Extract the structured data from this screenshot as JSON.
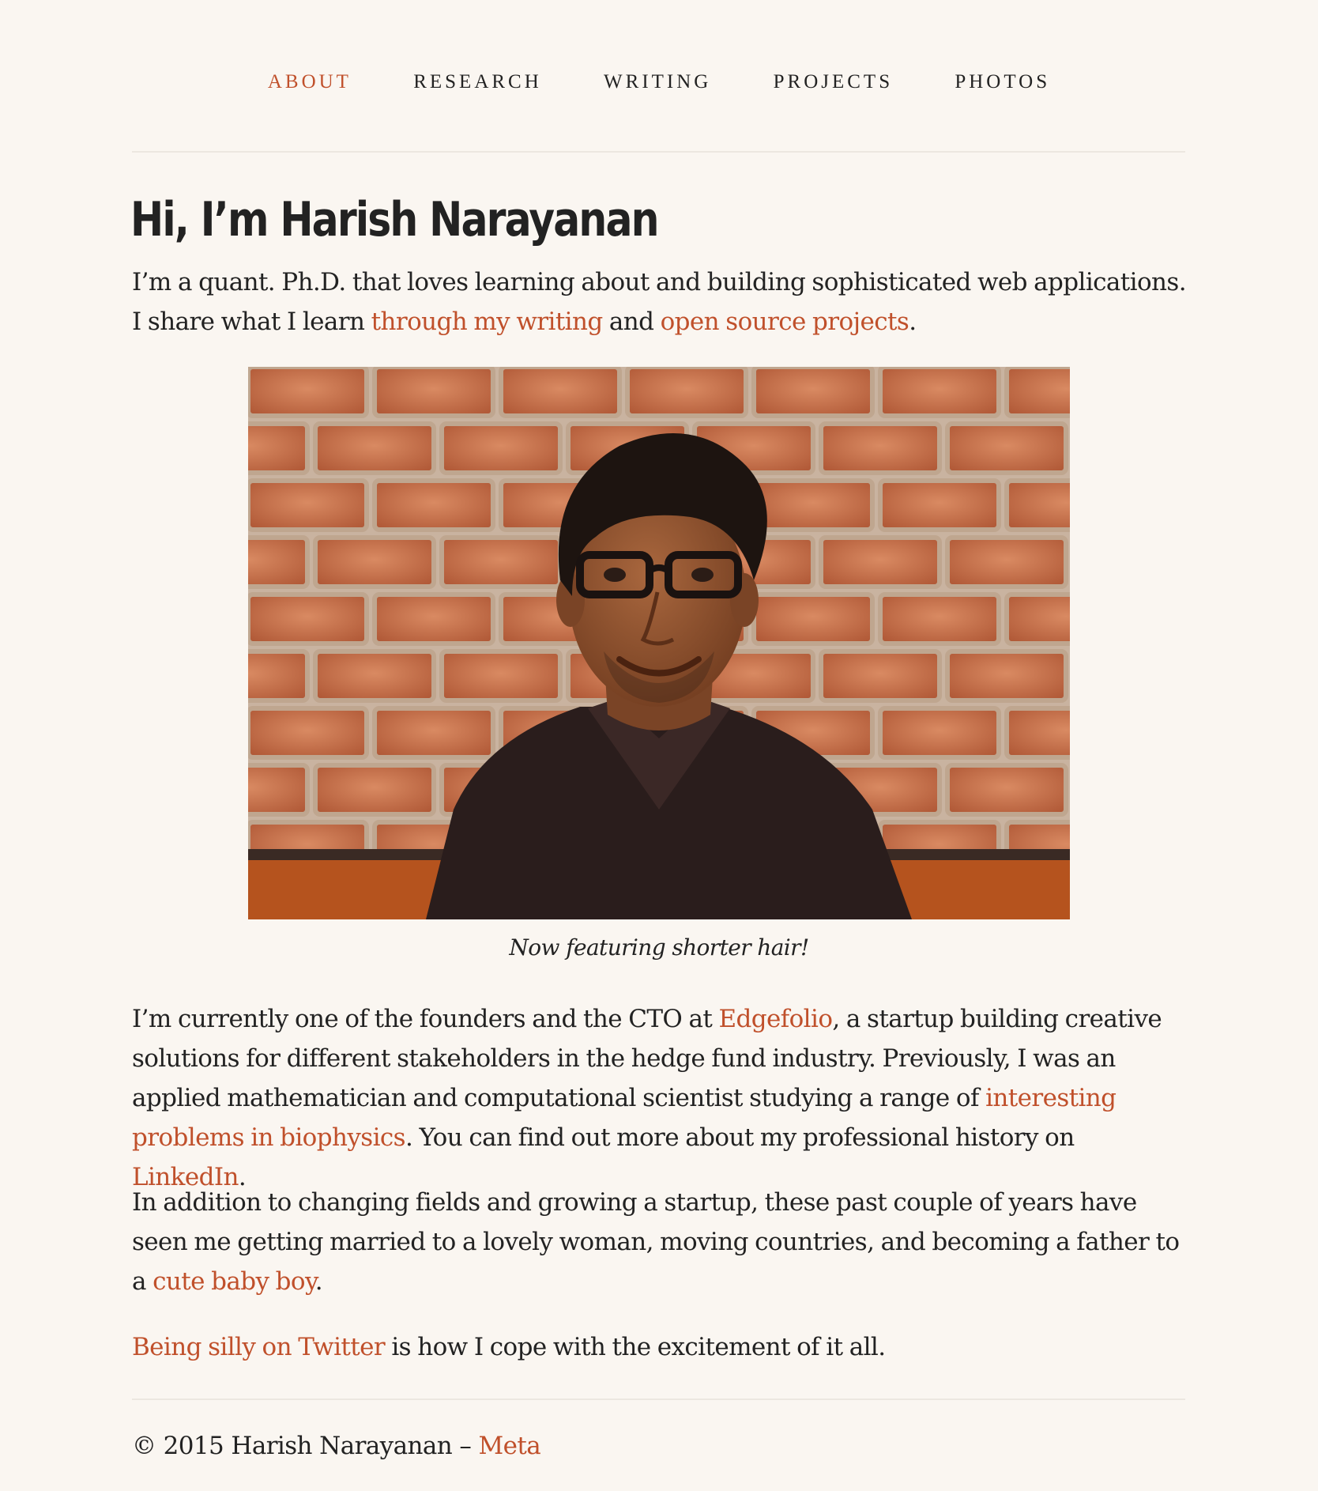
{
  "nav": {
    "items": [
      {
        "label": "About",
        "active": true
      },
      {
        "label": "Research",
        "active": false
      },
      {
        "label": "Writing",
        "active": false
      },
      {
        "label": "Projects",
        "active": false
      },
      {
        "label": "Photos",
        "active": false
      }
    ]
  },
  "colors": {
    "background": "#faf6f1",
    "text": "#222222",
    "accent": "#c0502b",
    "rule": "#ece7e0"
  },
  "heading": "Hi, I’m Harish Narayanan",
  "intro": {
    "text_1": "I’m a quant. Ph.D. that loves learning about and building sophisticated web applications. I share what I learn ",
    "link_writing": "through my writing",
    "text_2": " and ",
    "link_projects": "open source projects",
    "text_3": "."
  },
  "photo": {
    "caption": "Now featuring shorter hair!"
  },
  "work": {
    "text_1": "I’m currently one of the founders and the CTO at ",
    "link_company": "Edgefolio",
    "text_2": ", a startup building creative solutions for different stakeholders in the hedge fund industry. Previously, I was an applied mathematician and computational scientist studying a range of ",
    "link_research": "interesting problems in biophysics",
    "text_3": ". You can find out more about my professional history on ",
    "link_linkedin": "LinkedIn",
    "text_4": "."
  },
  "life": {
    "text_1": "In addition to changing fields and growing a startup, these past couple of years have seen me getting married to a lovely woman, moving countries, and becoming a father to a ",
    "link_baby": "cute baby boy",
    "text_2": "."
  },
  "silly": {
    "link_twitter": "Being silly on Twitter",
    "text_1": " is how I cope with the excitement of it all."
  },
  "footer": {
    "copyright": "© 2015 Harish Narayanan – ",
    "link_meta": "Meta"
  }
}
